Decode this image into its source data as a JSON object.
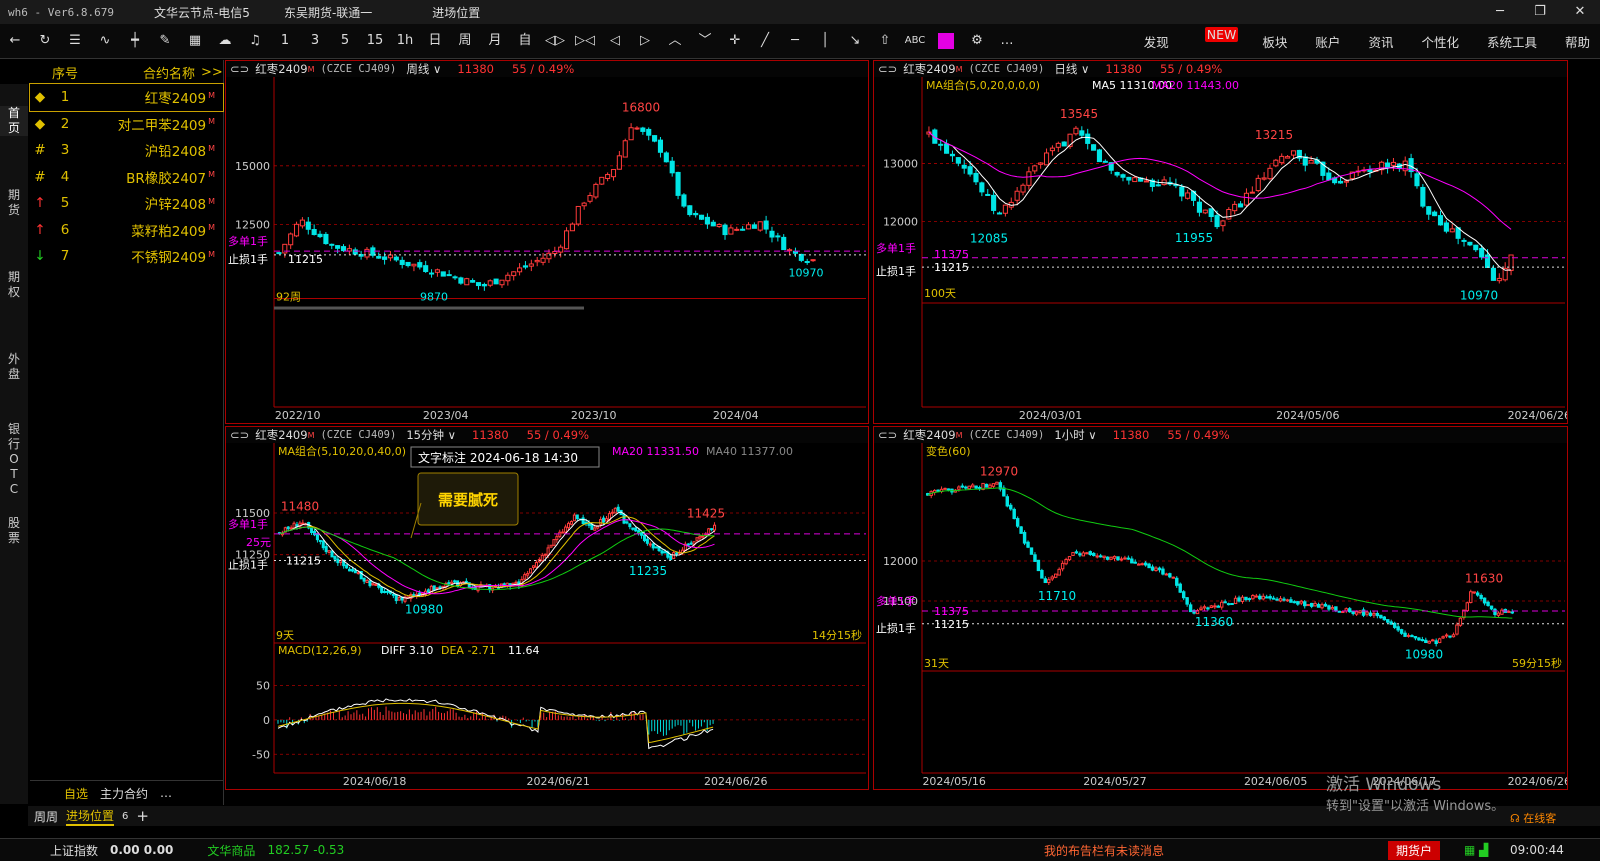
{
  "app": {
    "version": "wh6 - Ver6.8.679",
    "node": "文华云节点-电信5",
    "broker": "东吴期货-联通一",
    "window_title": "进场位置"
  },
  "toolbar": {
    "icons": [
      "back-icon",
      "refresh-icon",
      "list-icon",
      "line-chart-icon",
      "candle-icon",
      "pen-icon",
      "grid-icon",
      "cloud-icon",
      "bell-icon"
    ],
    "periods": [
      "1",
      "3",
      "5",
      "15",
      "1h",
      "日",
      "周",
      "月",
      "自"
    ],
    "draw_icons": [
      "expand-icon",
      "shrink-icon",
      "left-icon",
      "right-icon",
      "up-icon",
      "down-icon",
      "crosshair-icon",
      "line-tool-icon",
      "hline-tool-icon",
      "vline-tool-icon",
      "arrow-tool-icon",
      "up-arrow-tool-icon"
    ],
    "text_tool": "ABC",
    "color_swatch": "#e400e4",
    "more": "…"
  },
  "menu": {
    "items": [
      "发现",
      "板块",
      "账户",
      "资讯",
      "个性化",
      "系统工具",
      "帮助"
    ],
    "new_badge": "NEW"
  },
  "left_tabs": [
    "首页",
    "期货",
    "期权",
    "外盘",
    "银行OTC",
    "股票"
  ],
  "watchlist": {
    "col_no": "序号",
    "col_name": "合约名称",
    "more": ">>",
    "rows": [
      {
        "mark": "◆",
        "mark_color": "#e0c000",
        "no": "1",
        "name": "红枣2409",
        "sup": "M"
      },
      {
        "mark": "◆",
        "mark_color": "#e0c000",
        "no": "2",
        "name": "对二甲苯2409",
        "sup": "M"
      },
      {
        "mark": "#",
        "mark_color": "#e0c000",
        "no": "3",
        "name": "沪铅2408",
        "sup": "M"
      },
      {
        "mark": "#",
        "mark_color": "#e0c000",
        "no": "4",
        "name": "BR橡胶2407",
        "sup": "M"
      },
      {
        "mark": "↑",
        "mark_color": "#ff3333",
        "no": "5",
        "name": "沪锌2408",
        "sup": "M"
      },
      {
        "mark": "↑",
        "mark_color": "#ff3333",
        "no": "6",
        "name": "菜籽粕2409",
        "sup": "M"
      },
      {
        "mark": "↓",
        "mark_color": "#22cc22",
        "no": "7",
        "name": "不锈钢2409",
        "sup": "M"
      }
    ],
    "foot_tabs": [
      "自选",
      "主力合约",
      "…"
    ]
  },
  "panels": {
    "weekly": {
      "name": "红枣2409",
      "sup": "M",
      "code": "(CZCE CJ409)",
      "period": "周线",
      "price": "11380",
      "change": "55 / 0.49%",
      "y_ticks": [
        {
          "v": 15000,
          "t": "15000"
        },
        {
          "v": 12500,
          "t": "12500"
        }
      ],
      "x_ticks": [
        {
          "pos": 0.04,
          "t": "2022/10"
        },
        {
          "pos": 0.29,
          "t": "2023/04"
        },
        {
          "pos": 0.54,
          "t": "2023/10"
        },
        {
          "pos": 0.78,
          "t": "2024/04"
        }
      ],
      "high": "16800",
      "low": "9870",
      "last_low": "10970",
      "count": "92周",
      "long_label": "多单1手",
      "stop_label": "止损1手",
      "stop_value": "11215"
    },
    "daily": {
      "name": "红枣2409",
      "sup": "M",
      "code": "(CZCE CJ409)",
      "period": "日线",
      "price": "11380",
      "change": "55 / 0.49%",
      "ma_label": "MA组合(5,0,20,0,0,0)",
      "ma5": "MA5 11310.00",
      "ma20": "MA20 11443.00",
      "y_ticks": [
        {
          "v": 13000,
          "t": "13000"
        },
        {
          "v": 12000,
          "t": "12000"
        }
      ],
      "x_ticks": [
        {
          "pos": 0.2,
          "t": "2024/03/01"
        },
        {
          "pos": 0.6,
          "t": "2024/05/06"
        },
        {
          "pos": 0.96,
          "t": "2024/06/26"
        }
      ],
      "labels": [
        "13545",
        "13215",
        "12085",
        "11955",
        "10970"
      ],
      "count": "100天",
      "long_label": "多单1手",
      "long_value": "11375",
      "stop_label": "止损1手",
      "stop_value": "11215"
    },
    "m15": {
      "name": "红枣2409",
      "sup": "M",
      "code": "(CZCE CJ409)",
      "period": "15分钟",
      "price": "11380",
      "change": "55 / 0.49%",
      "ma_label": "MA组合(5,10,20,0,40,0)",
      "ma20": "MA20 11331.50",
      "ma40": "MA40 11377.00",
      "tooltip": "文字标注 2024-06-18 14:30",
      "note": "需要腻死",
      "y_ticks": [
        {
          "v": 11500,
          "t": "11500"
        },
        {
          "v": 11250,
          "t": "11250"
        }
      ],
      "x_ticks": [
        {
          "pos": 0.17,
          "t": "2024/06/18"
        },
        {
          "pos": 0.48,
          "t": "2024/06/21"
        },
        {
          "pos": 0.78,
          "t": "2024/06/26"
        }
      ],
      "labels": [
        "11480",
        "11425",
        "11235",
        "10980"
      ],
      "count": "9天",
      "timer": "14分15秒",
      "long_label": "多单1手",
      "long_sub": "25元",
      "stop_label": "止损1手",
      "stop_value": "11215",
      "macd_label": "MACD(12,26,9)",
      "diff": "DIFF 3.10",
      "dea": "DEA -2.71",
      "macd_val": "11.64",
      "macd_ticks": [
        {
          "v": 50,
          "t": "50"
        },
        {
          "v": 0,
          "t": "0"
        },
        {
          "v": -50,
          "t": "-50"
        }
      ]
    },
    "h1": {
      "name": "红枣2409",
      "sup": "M",
      "code": "(CZCE CJ409)",
      "period": "1小时",
      "price": "11380",
      "change": "55 / 0.49%",
      "ind_label": "变色(60)",
      "y_ticks": [
        {
          "v": 12000,
          "t": "12000"
        },
        {
          "v": 11500,
          "t": "11500"
        }
      ],
      "x_ticks": [
        {
          "pos": 0.05,
          "t": "2024/05/16"
        },
        {
          "pos": 0.3,
          "t": "2024/05/27"
        },
        {
          "pos": 0.55,
          "t": "2024/06/05"
        },
        {
          "pos": 0.75,
          "t": "2024/06/17"
        },
        {
          "pos": 0.96,
          "t": "2024/06/26"
        }
      ],
      "labels": [
        "12970",
        "11710",
        "11360",
        "10980",
        "11630"
      ],
      "count": "31天",
      "timer": "59分15秒",
      "long_label": "多单1手",
      "long_value": "11375",
      "stop_label": "止损1手",
      "stop_value": "11215"
    }
  },
  "bottom_tabs": {
    "items": [
      "周周",
      "进场位置"
    ],
    "count": "6",
    "add": "+"
  },
  "status": {
    "index_name": "上证指数",
    "index_vals": "0.00  0.00",
    "wh_name": "文华商品",
    "wh_vals": "182.57  -0.53",
    "msg": "我的布告栏有未读消息",
    "account": "期货户",
    "time": "09:00:44",
    "online": "在线客"
  },
  "watermark": {
    "line1": "激活 Windows",
    "line2": "转到\"设置\"以激活 Windows。"
  }
}
